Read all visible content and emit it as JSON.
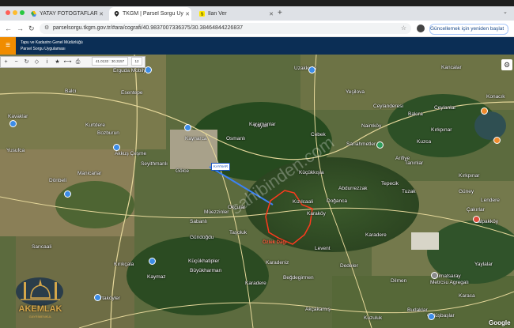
{
  "tabs": [
    {
      "label": "YATAY FOTOĞTAFLAR - Goo",
      "active": false,
      "favicon": "google-drive-icon"
    },
    {
      "label": "TKGM | Parsel Sorgu Uygulama",
      "active": true,
      "favicon": "map-pin-icon"
    },
    {
      "label": "İlan Ver",
      "active": false,
      "favicon": "sahibinden-icon"
    }
  ],
  "toolbar": {
    "url": "parselsorgu.tkgm.gov.tr/#ara/cografi/40.9837007336375/30.38464844226837",
    "update_button": "Güncellemek için yeniden başlat"
  },
  "app": {
    "title_line1": "Tapu ve Kadastro Genel Müdürlüğü",
    "title_line2": "Parsel Sorgu Uygulaması"
  },
  "map": {
    "coords": "41.0133 : 30.3157",
    "zoom": "12",
    "marker_tag": "KAYNAR",
    "watermark": "sahibinden.com",
    "attribution": "Google",
    "logo_text": "AKEMLAK",
    "logo_sub": "GAYRİMENKUL",
    "places": [
      "Erguda Mobilya",
      "Uzakkışla",
      "Kancalar",
      "Balcı",
      "Esentepe",
      "Yeşilova",
      "Ceylanderesi",
      "Ceylanlar",
      "Konacık",
      "Kurtdere",
      "Bozburun",
      "Kayalı",
      "Karamanlar",
      "Bakıra",
      "Kırkpınar",
      "Kavaklar",
      "Kaynarca",
      "Osmanlı",
      "Naimköy",
      "Kuzca",
      "Yusufca",
      "Akkuş Çeşme",
      "Cebek",
      "Sarıahmetler",
      "Arifiye",
      "Seyithmanlı",
      "Manicarlar",
      "Dönbeli",
      "Küçükkışla",
      "Gölce",
      "Kızılcaali",
      "Abdurrezzak",
      "Tepecik",
      "Tuzak",
      "Doğanca",
      "Karadere",
      "Güney",
      "Karaköy",
      "Müezzinler",
      "Okçular",
      "Taşoluk",
      "Sarıcaali",
      "Sabanlı",
      "Karadeniz",
      "Levent",
      "Kalpakköy",
      "Çakırlar",
      "Kaymaz",
      "Kırıkçala",
      "Kumatsaray",
      "Dilmen",
      "Karaca",
      "Yaylalar",
      "Küçükhatipler",
      "Büyükharman",
      "Karadere",
      "Dedeler",
      "Beğdegirmen",
      "Metrcsu Agregalı",
      "Akçakamış",
      "Ortaköyler",
      "Budaklar",
      "Kuzuluk",
      "Özlek Dağı",
      "Tanınlar",
      "Gündoğdu",
      "Kırkpınar",
      "Lendere",
      "Gülüşbaşlar"
    ]
  },
  "colors": {
    "header_bg": "#0b2e55",
    "menu_btn": "#f08c00",
    "parcel_outline": "#ff3a1e",
    "route_line": "#3b82f6"
  }
}
